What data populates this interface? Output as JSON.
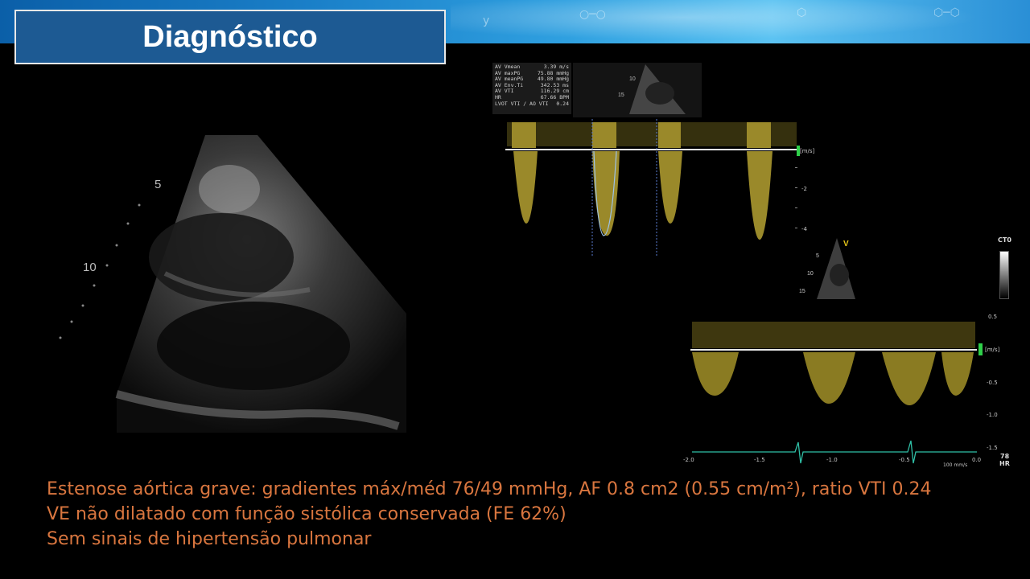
{
  "slide": {
    "title": "Diagnóstico"
  },
  "cw_doppler": {
    "measurements": [
      {
        "label": "AV Vmean",
        "value": "3.39 m/s"
      },
      {
        "label": "AV maxPG",
        "value": "75.88 mmHg"
      },
      {
        "label": "AV meanPG",
        "value": "49.80 mmHg"
      },
      {
        "label": "AV Env.Ti",
        "value": "342.53 ms"
      },
      {
        "label": "AV VTI",
        "value": "116.29 cm"
      },
      {
        "label": "HR",
        "value": "67.66 BPM"
      },
      {
        "label": "LVOT VTI / AO VTI",
        "value": "0.24"
      }
    ],
    "unit": "[m/s]",
    "ticks": [
      "-2",
      "-4"
    ],
    "depth_marks": [
      "10",
      "15"
    ]
  },
  "pw_doppler": {
    "unit": "[m/s]",
    "ticks": [
      "0.5",
      "-0.5",
      "-1.0",
      "-1.5"
    ],
    "time_ticks": [
      "-2.0",
      "-1.5",
      "-1.0",
      "-0.5",
      "0.0"
    ],
    "speed": "100 mm/s",
    "hr_value": "78",
    "hr_label": "HR",
    "depth_marks": [
      "5",
      "10",
      "15"
    ],
    "v_marker": "V"
  },
  "echo_2d": {
    "depth_marks": [
      "5",
      "10"
    ]
  },
  "colorbar": {
    "label": "CT0"
  },
  "findings": [
    "Estenose aórtica grave:  gradientes máx/méd 76/49 mmHg, AF 0.8 cm2 (0.55 cm/m²), ratio VTI 0.24",
    "VE não dilatado com função sistólica conservada (FE 62%)",
    "Sem sinais de hipertensão pulmonar"
  ]
}
